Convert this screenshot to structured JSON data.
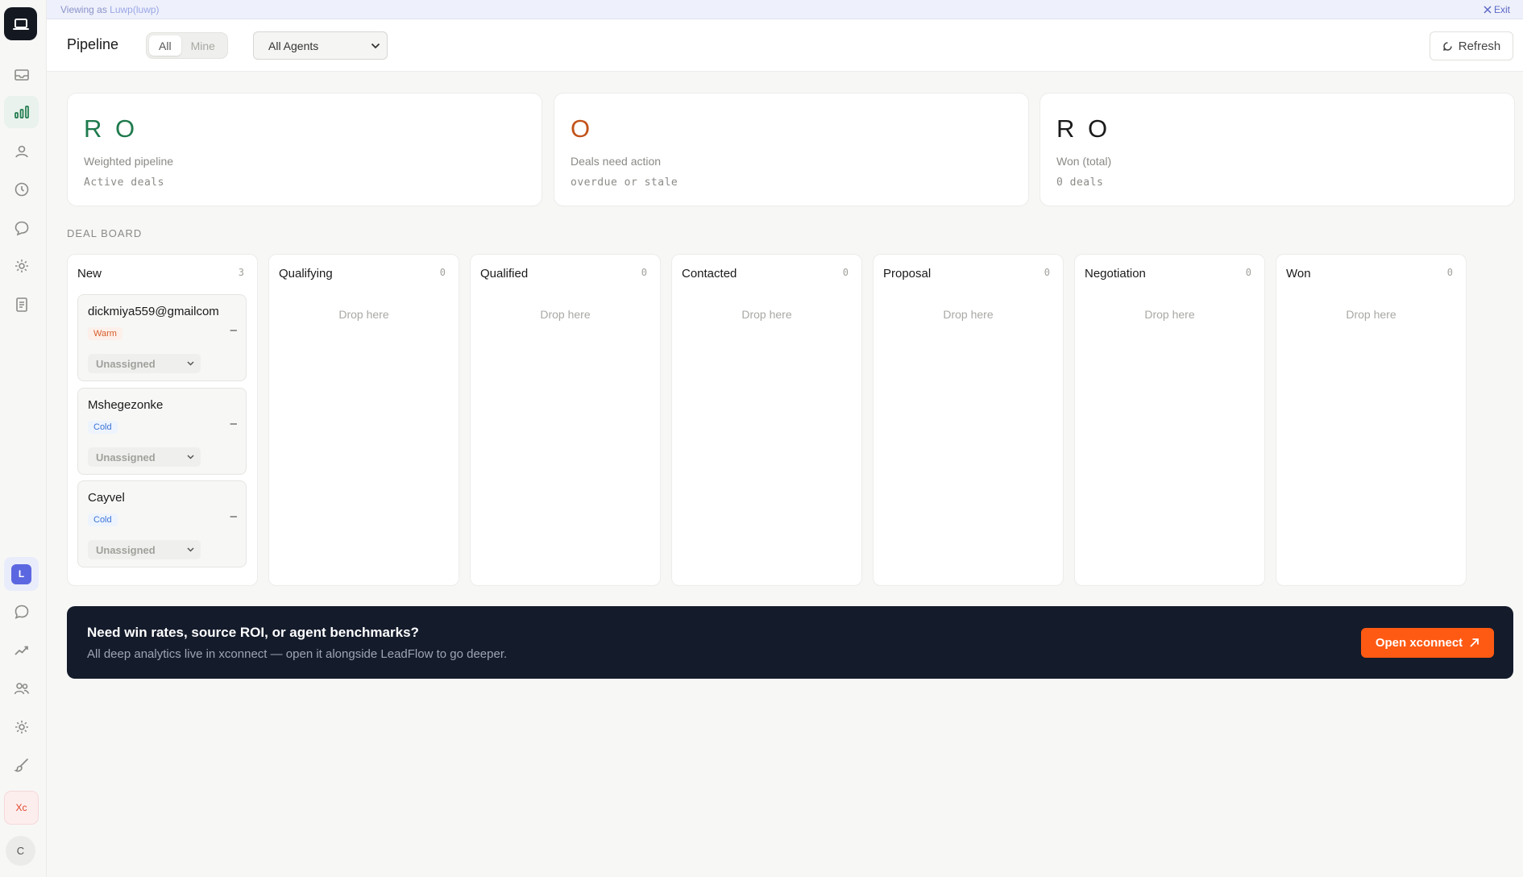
{
  "banner": {
    "viewing_label": "Viewing as",
    "viewing_user": "Luwp(luwp)",
    "exit_label": "Exit"
  },
  "sidebar": {
    "items": [
      {
        "name": "inbox-icon",
        "active": false
      },
      {
        "name": "pipeline-chart-icon",
        "active": true
      },
      {
        "name": "contacts-icon",
        "active": false
      },
      {
        "name": "clock-icon",
        "active": false
      },
      {
        "name": "chat-bubble-icon",
        "active": false
      },
      {
        "name": "settings-gear-icon",
        "active": false
      },
      {
        "name": "document-icon",
        "active": false
      }
    ],
    "user_initial": "L",
    "xc_label": "Xc",
    "avatar_initial": "C"
  },
  "header": {
    "title": "Pipeline",
    "filter_all": "All",
    "filter_mine": "Mine",
    "agent_select": "All Agents",
    "refresh_label": "Refresh"
  },
  "stats": [
    {
      "value": "R O",
      "label": "Weighted pipeline",
      "sub": "Active deals",
      "color": "#1f7a4d"
    },
    {
      "value": "O",
      "label": "Deals need action",
      "sub": "overdue or stale",
      "color": "#c2531a"
    },
    {
      "value": "R O",
      "label": "Won (total)",
      "sub": "0 deals",
      "color": "#1a1a1a"
    }
  ],
  "board": {
    "section_label": "DEAL BOARD",
    "drop_label": "Drop here",
    "columns": [
      {
        "title": "New",
        "count": "3"
      },
      {
        "title": "Qualifying",
        "count": "0"
      },
      {
        "title": "Qualified",
        "count": "0"
      },
      {
        "title": "Contacted",
        "count": "0"
      },
      {
        "title": "Proposal",
        "count": "0"
      },
      {
        "title": "Negotiation",
        "count": "0"
      },
      {
        "title": "Won",
        "count": "0"
      }
    ],
    "cards": [
      {
        "name": "dickmiya559@gmailcom",
        "temp": "Warm",
        "value": "–",
        "assignee": "Unassigned"
      },
      {
        "name": "Mshegezonke",
        "temp": "Cold",
        "value": "–",
        "assignee": "Unassigned"
      },
      {
        "name": "Cayvel",
        "temp": "Cold",
        "value": "–",
        "assignee": "Unassigned"
      }
    ]
  },
  "cta": {
    "title": "Need win rates, source ROI, or agent benchmarks?",
    "subtitle": "All deep analytics live in xconnect — open it alongside LeadFlow to go deeper.",
    "button_label": "Open xconnect"
  },
  "colors": {
    "accent_green": "#1f7a4d",
    "warm": "#d65c2a",
    "cold": "#3b73d6",
    "cta_bg": "#141b2b",
    "cta_button": "#ff5a14"
  }
}
